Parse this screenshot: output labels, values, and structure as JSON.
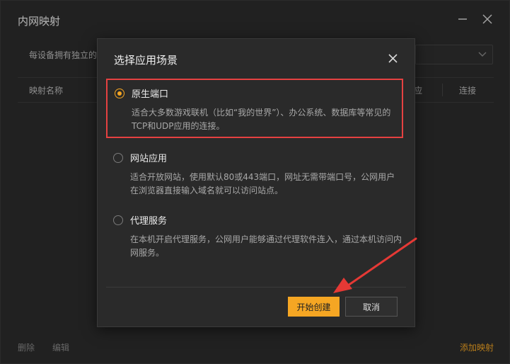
{
  "window": {
    "title": "内网映射",
    "minimize_icon": "minus-icon",
    "close_icon": "close-icon"
  },
  "main": {
    "description": "每设备拥有独立的",
    "table": {
      "headers": [
        "映射名称",
        "应",
        "连接"
      ]
    },
    "footer": {
      "delete_label": "删除",
      "edit_label": "编辑",
      "add_label": "添加映射"
    }
  },
  "dialog": {
    "title": "选择应用场景",
    "options": [
      {
        "label": "原生端口",
        "description": "适合大多数游戏联机（比如“我的世界”）、办公系统、数据库等常见的TCP和UDP应用的连接。",
        "selected": true
      },
      {
        "label": "网站应用",
        "description": "适合开放网站，使用默认80或443端口，网址无需带端口号，公网用户在浏览器直接输入域名就可以访问站点。",
        "selected": false
      },
      {
        "label": "代理服务",
        "description": "在本机开启代理服务，公网用户能够通过代理软件连入，通过本机访问内网服务。",
        "selected": false
      }
    ],
    "primary_button": "开始创建",
    "cancel_button": "取消"
  },
  "colors": {
    "accent": "#f5a623",
    "highlight_box": "#e54141",
    "annotation_arrow": "#e53935"
  }
}
